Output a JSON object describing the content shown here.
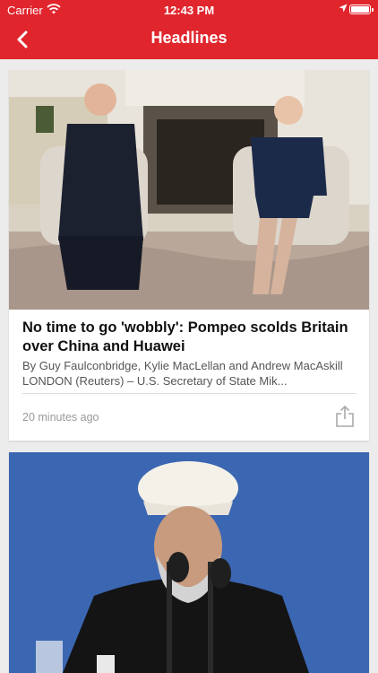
{
  "status_bar": {
    "carrier": "Carrier",
    "time": "12:43 PM"
  },
  "nav": {
    "title": "Headlines",
    "back_icon": "chevron-left-icon"
  },
  "theme": {
    "brand_red": "#e0252d"
  },
  "articles": [
    {
      "headline": "No time to go 'wobbly': Pompeo scolds Britain over China and Huawei",
      "summary": "By Guy Faulconbridge, Kylie MacLellan and Andrew MacAskill LONDON (Reuters) – U.S. Secretary of State Mik...",
      "timestamp": "20 minutes ago",
      "share_icon": "share-icon"
    },
    {
      "image_only": true
    }
  ]
}
